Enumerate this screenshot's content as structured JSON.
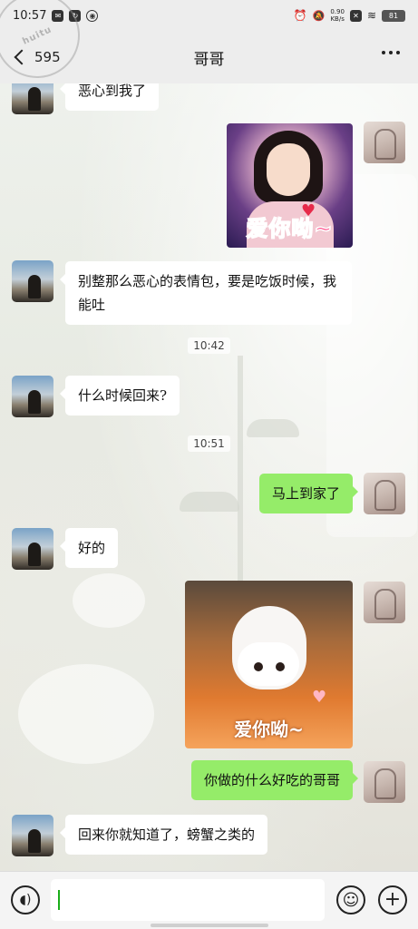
{
  "status_bar": {
    "time": "10:57",
    "speed_value": "0.90",
    "speed_unit": "KB/s",
    "battery": "81"
  },
  "nav": {
    "back_label": "595",
    "title": "哥哥"
  },
  "watermark": "huitu",
  "messages": {
    "m1": "恶心到我了",
    "m3": "别整那么恶心的表情包，要是吃饭时候，我能吐",
    "t1": "10:42",
    "m4": "什么时候回来?",
    "t2": "10:51",
    "m5": "马上到家了",
    "m6": "好的",
    "m8": "你做的什么好吃的哥哥",
    "m9": "回来你就知道了，螃蟹之类的"
  },
  "stickers": {
    "girl_text": "爱你呦~",
    "cat_text": "爱你呦~"
  },
  "colors": {
    "self_bubble": "#95ec69",
    "other_bubble": "#ffffff",
    "caret": "#1aad19"
  },
  "icons": {
    "voice": "voice-icon",
    "emoji": "emoji-icon",
    "plus": "plus-icon",
    "more": "more-icon",
    "back": "chevron-left-icon"
  }
}
